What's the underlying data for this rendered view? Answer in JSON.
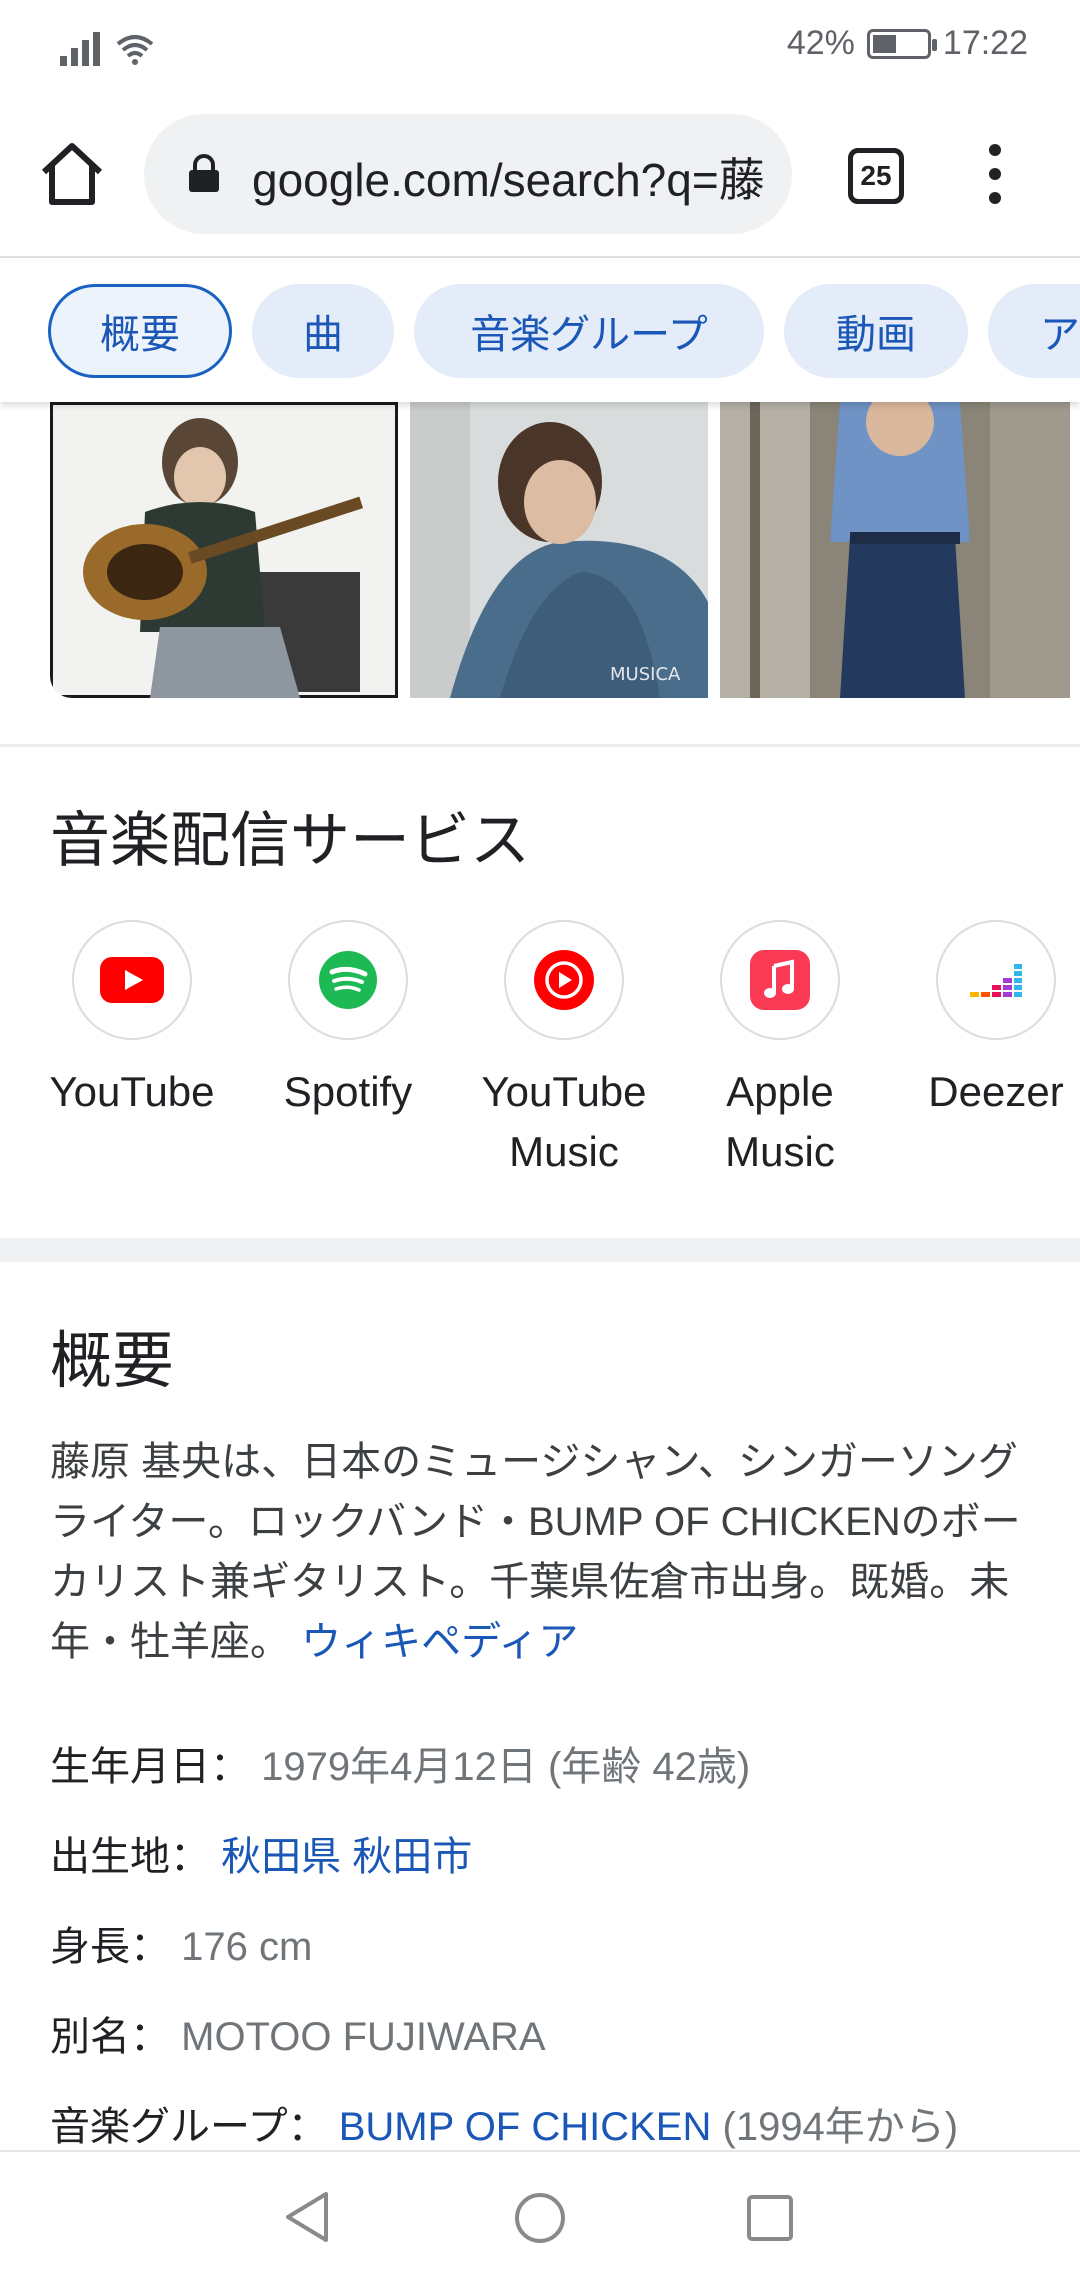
{
  "status": {
    "battery": "42%",
    "time": "17:22",
    "battery_level": 0.42
  },
  "browser": {
    "url": "google.com/search?q=藤",
    "tab_count": "25"
  },
  "chips": [
    "概要",
    "曲",
    "音楽グループ",
    "動画",
    "ア"
  ],
  "services": {
    "title": "音楽配信サービス",
    "items": [
      {
        "name": "YouTube",
        "icon": "youtube-icon"
      },
      {
        "name": "Spotify",
        "icon": "spotify-icon"
      },
      {
        "name": "YouTube Music",
        "icon": "youtube-music-icon"
      },
      {
        "name": "Apple Music",
        "icon": "apple-music-icon"
      },
      {
        "name": "Deezer",
        "icon": "deezer-icon"
      }
    ]
  },
  "overview": {
    "title": "概要",
    "description": "藤原 基央は、日本のミュージシャン、シンガーソングライター。ロックバンド・BUMP OF CHICKENのボーカリスト兼ギタリスト。千葉県佐倉市出身。既婚。未年・牡羊座。",
    "source_link": "ウィキペディア",
    "facts": {
      "birth_label": "生年月日：",
      "birth_value": "1979年4月12日 (年齢 42歳)",
      "birthplace_label": "出生地：",
      "birthplace_value": "秋田県 秋田市",
      "height_label": "身長：",
      "height_value": "176 cm",
      "alias_label": "別名：",
      "alias_value": "MOTOO FUJIWARA",
      "group_label": "音楽グループ：",
      "group_link": "BUMP OF CHICKEN",
      "group_years": "(1994年から)"
    }
  }
}
